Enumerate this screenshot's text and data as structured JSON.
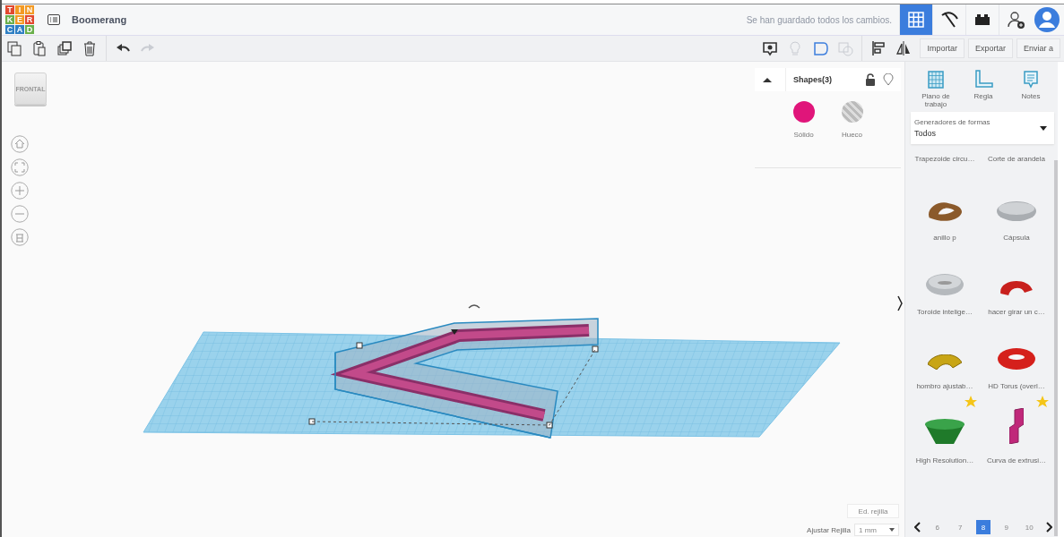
{
  "logo": {
    "letters": [
      "T",
      "I",
      "N",
      "K",
      "E",
      "R",
      "C",
      "A",
      "D"
    ]
  },
  "title": "Boomerang",
  "save_status": "Se han guardado todos los cambios.",
  "view_buttons": [
    {
      "kind": "grid",
      "selected": true
    },
    {
      "kind": "pickaxe",
      "selected": false
    },
    {
      "kind": "brick",
      "selected": false
    }
  ],
  "edit_tools": [
    {
      "kind": "copy",
      "disabled": false
    },
    {
      "kind": "paste",
      "disabled": false
    },
    {
      "kind": "duplicate",
      "disabled": false
    },
    {
      "kind": "delete",
      "disabled": false
    },
    {
      "kind": "undo",
      "disabled": false
    },
    {
      "kind": "redo",
      "disabled": true
    }
  ],
  "shape_tools": [
    {
      "kind": "note",
      "disabled": false
    },
    {
      "kind": "light",
      "disabled": true
    },
    {
      "kind": "group",
      "disabled": false
    },
    {
      "kind": "ungroup",
      "disabled": true
    },
    {
      "kind": "align",
      "disabled": false
    },
    {
      "kind": "mirror",
      "disabled": false
    }
  ],
  "buttons": [
    "Importar",
    "Exportar",
    "Enviar a"
  ],
  "view_cube": "FRONTAL",
  "inspector": {
    "title": "Shapes(3)",
    "options": [
      {
        "kind": "solid",
        "label": "Sólido"
      },
      {
        "kind": "hole",
        "label": "Hueco"
      }
    ]
  },
  "panel_tools": [
    {
      "kind": "workplane",
      "label": "Plano de trabajo"
    },
    {
      "kind": "ruler",
      "label": "Regla"
    },
    {
      "kind": "notes",
      "label": "Notes"
    }
  ],
  "library": {
    "caption": "Generadores de formas",
    "value": "Todos"
  },
  "shapes": [
    {
      "kind": "none",
      "label": "Trapezoide circu…",
      "starred": false
    },
    {
      "kind": "none",
      "label": "Corte de arandela",
      "starred": false
    },
    {
      "kind": "ring",
      "label": "anillo p",
      "starred": false
    },
    {
      "kind": "capsule",
      "label": "Cápsula",
      "starred": false
    },
    {
      "kind": "toroid",
      "label": "Toroide intelige…",
      "starred": false
    },
    {
      "kind": "spin",
      "label": "hacer girar un c…",
      "starred": false
    },
    {
      "kind": "shoulder",
      "label": "hombro ajustab…",
      "starred": false
    },
    {
      "kind": "torus",
      "label": "HD Torus (overl…",
      "starred": false
    },
    {
      "kind": "cone",
      "label": "High Resolution…",
      "starred": true
    },
    {
      "kind": "extrusion",
      "label": "Curva de extrusi…",
      "starred": true
    }
  ],
  "grid": {
    "edit": "Ed. rejilla",
    "snap_label": "Ajustar Rejilla",
    "snap_value": "1 mm"
  },
  "pages": [
    {
      "label": "6",
      "selected": false
    },
    {
      "label": "7",
      "selected": false
    },
    {
      "label": "8",
      "selected": true
    },
    {
      "label": "9",
      "selected": false
    },
    {
      "label": "10",
      "selected": false
    }
  ]
}
